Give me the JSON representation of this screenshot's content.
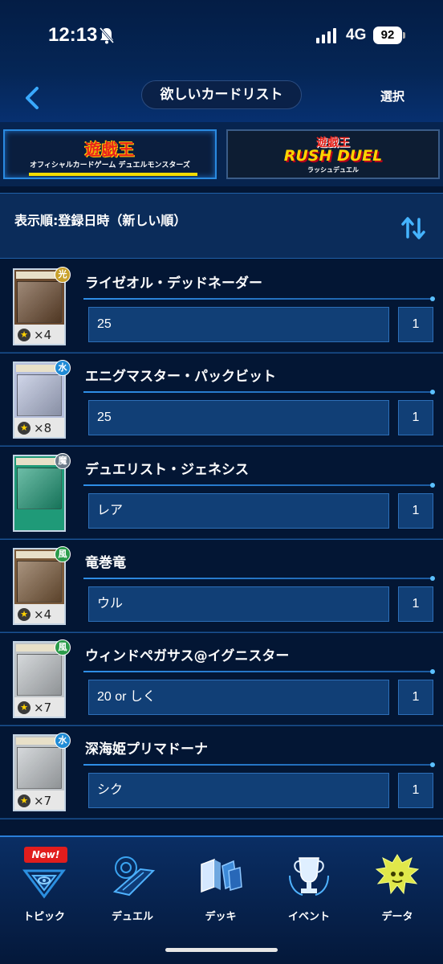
{
  "status_bar": {
    "time": "12:13",
    "network": "4G",
    "battery": "92"
  },
  "header": {
    "title": "欲しいカードリスト",
    "select_label": "選択"
  },
  "tabs": [
    {
      "logo_main": "遊戯王",
      "logo_sub": "オフィシャルカードゲーム デュエルモンスターズ",
      "active": true
    },
    {
      "logo_top": "遊戯王",
      "logo_main": "RUSH DUEL",
      "logo_sub": "ラッシュデュエル",
      "active": false
    }
  ],
  "sort": {
    "label": "表示順:登録日時（新しい順）"
  },
  "cards": [
    {
      "name": "ライゼオル・デッドネーダー",
      "memo": "25",
      "quantity": "1",
      "attribute": "光",
      "level_count": "×4",
      "thumb_color": "#6b4a2f"
    },
    {
      "name": "エニグマスター・パックビット",
      "memo": "25",
      "quantity": "1",
      "attribute": "水",
      "level_count": "×8",
      "thumb_color": "#b6bfdc"
    },
    {
      "name": "デュエリスト・ジェネシス",
      "memo": "レア",
      "quantity": "1",
      "attribute": "魔",
      "level_count": "",
      "thumb_color": "#1f9a78"
    },
    {
      "name": "竜巻竜",
      "memo": "ウル",
      "quantity": "1",
      "attribute": "風",
      "level_count": "×4",
      "thumb_color": "#7b5a3a"
    },
    {
      "name": "ウィンドペガサス@イグニスター",
      "memo": "20 or しく",
      "quantity": "1",
      "attribute": "風",
      "level_count": "×7",
      "thumb_color": "#bfc4c8"
    },
    {
      "name": "深海姫プリマドーナ",
      "memo": "シク",
      "quantity": "1",
      "attribute": "水",
      "level_count": "×7",
      "thumb_color": "#bfc4c8"
    }
  ],
  "bottom_nav": {
    "new_badge": "New!",
    "items": [
      {
        "label": "トピック",
        "icon": "topic-icon"
      },
      {
        "label": "デュエル",
        "icon": "duel-icon"
      },
      {
        "label": "デッキ",
        "icon": "deck-icon"
      },
      {
        "label": "イベント",
        "icon": "trophy-icon"
      },
      {
        "label": "データ",
        "icon": "data-icon"
      }
    ]
  }
}
